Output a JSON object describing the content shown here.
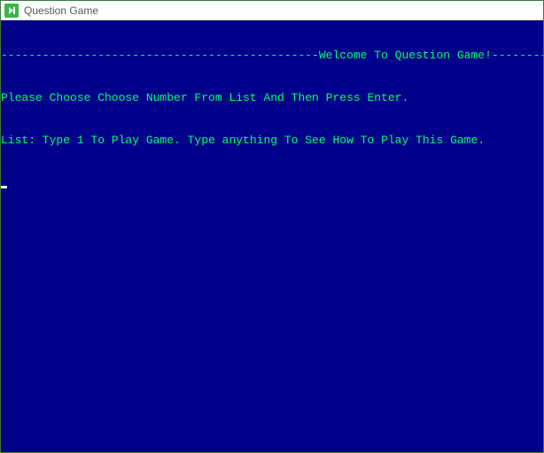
{
  "window": {
    "title": "Question Game"
  },
  "console": {
    "banner": "----------------------------------------------Welcome To Question Game!-----------------------------------------------",
    "line1": "Please Choose Choose Number From List And Then Press Enter.",
    "line2": "List: Type 1 To Play Game. Type anything To See How To Play This Game."
  }
}
